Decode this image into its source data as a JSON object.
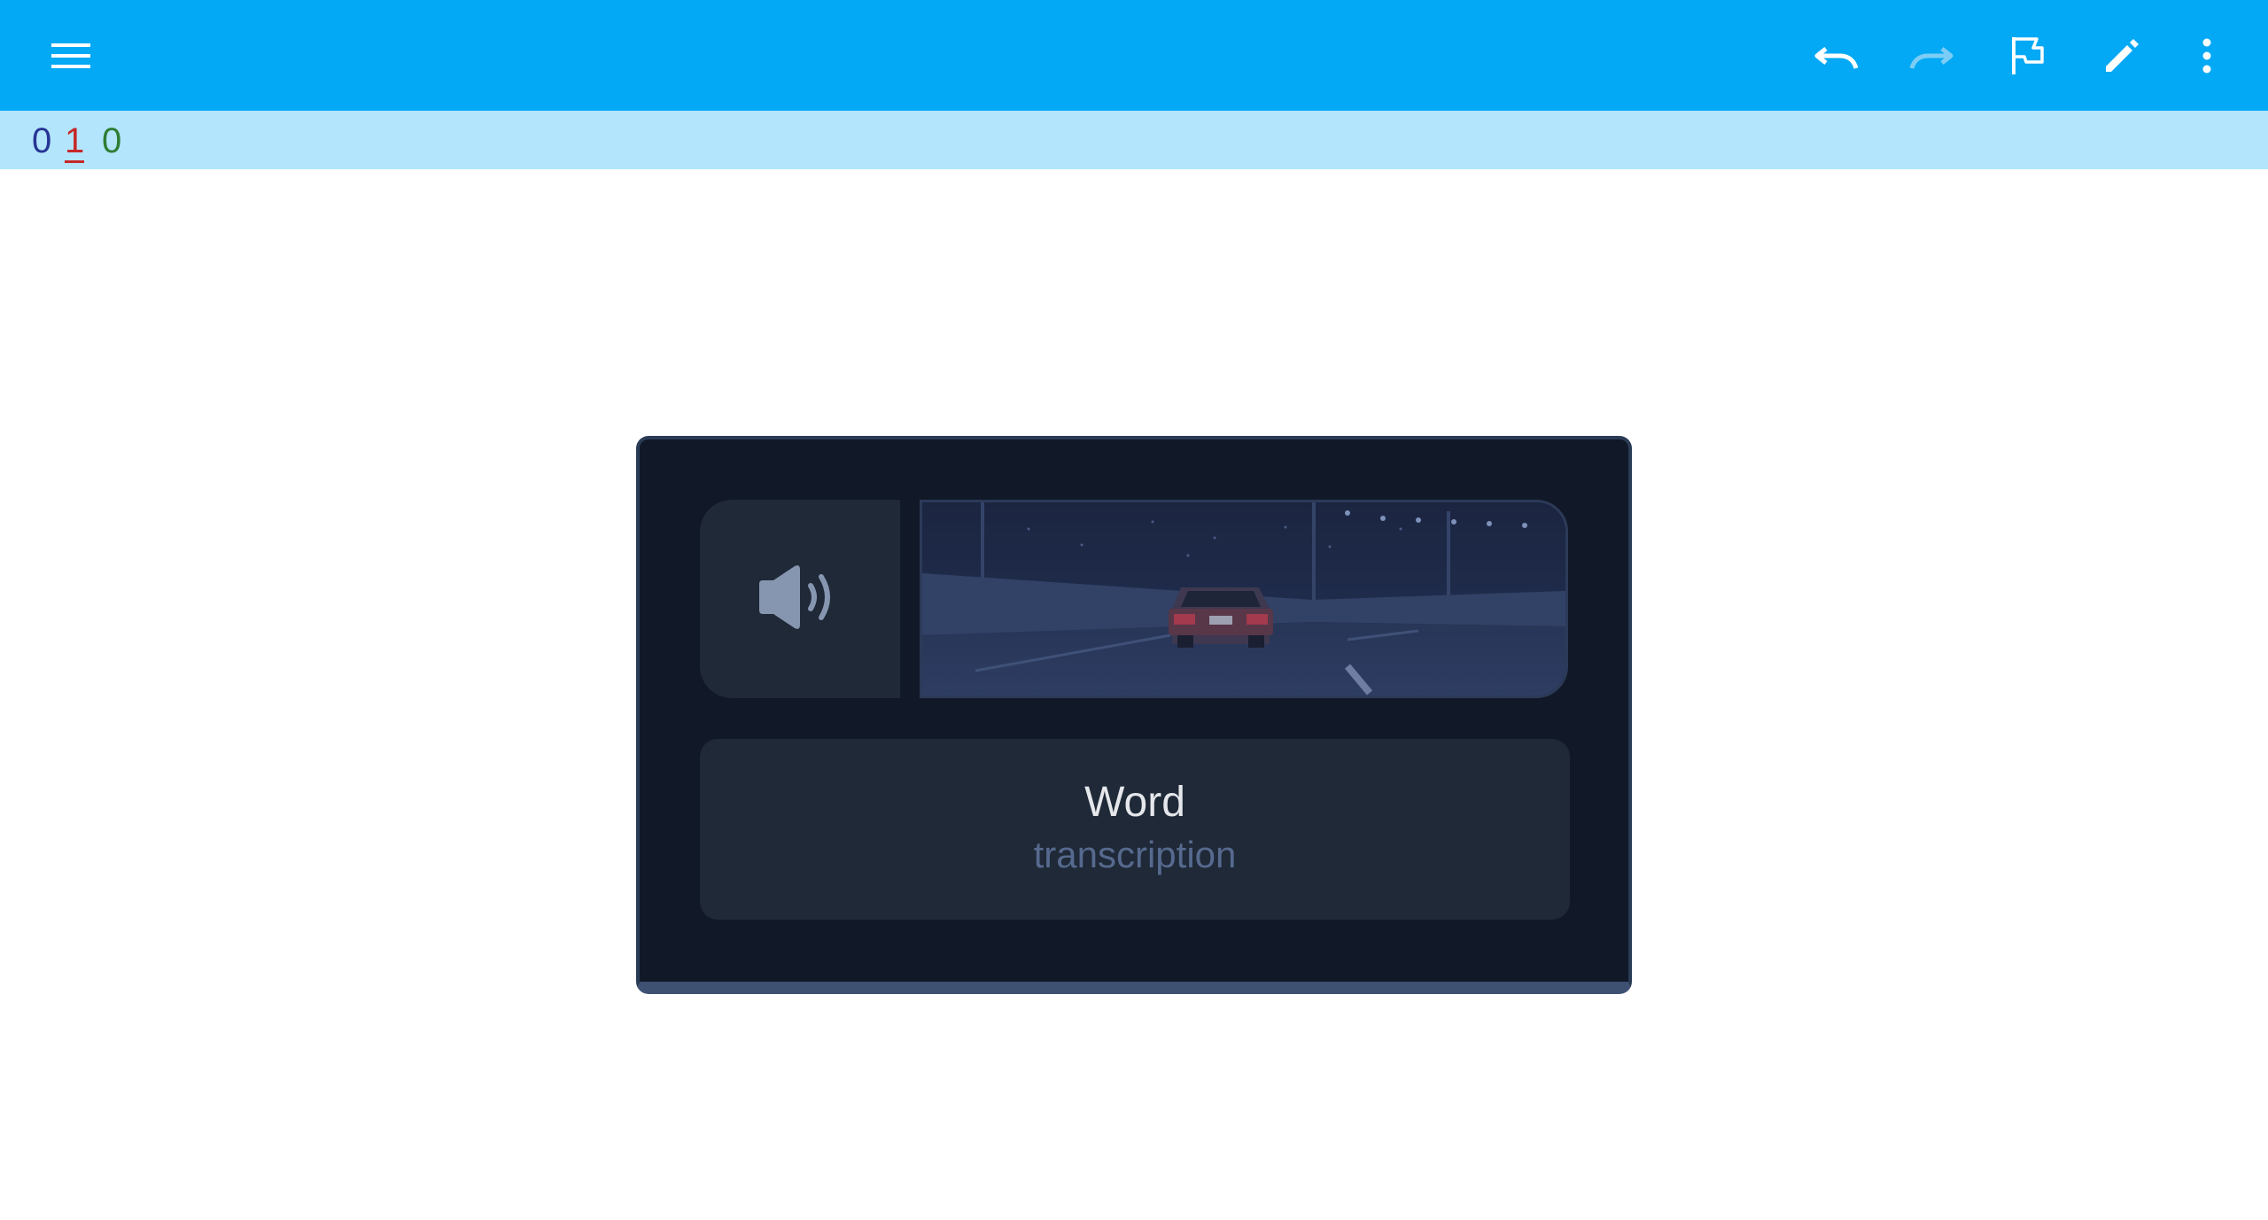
{
  "toolbar": {
    "background": "#03a9f4",
    "icons": {
      "menu": "menu-icon",
      "undo": "undo-icon",
      "redo": "redo-icon",
      "flag": "flag-icon",
      "edit": "edit-pencil-icon",
      "more": "more-vertical-icon"
    },
    "redo_enabled": false
  },
  "counts": {
    "new": "0",
    "learn": "1",
    "review": "0",
    "colors": {
      "new": "#283593",
      "learn": "#c62828",
      "review": "#2e7d32"
    }
  },
  "card": {
    "background": "#111827",
    "audio_icon": "speaker-icon",
    "image_description_icon": "night-highway-car-image",
    "word": "Word",
    "transcription": "transcription"
  }
}
